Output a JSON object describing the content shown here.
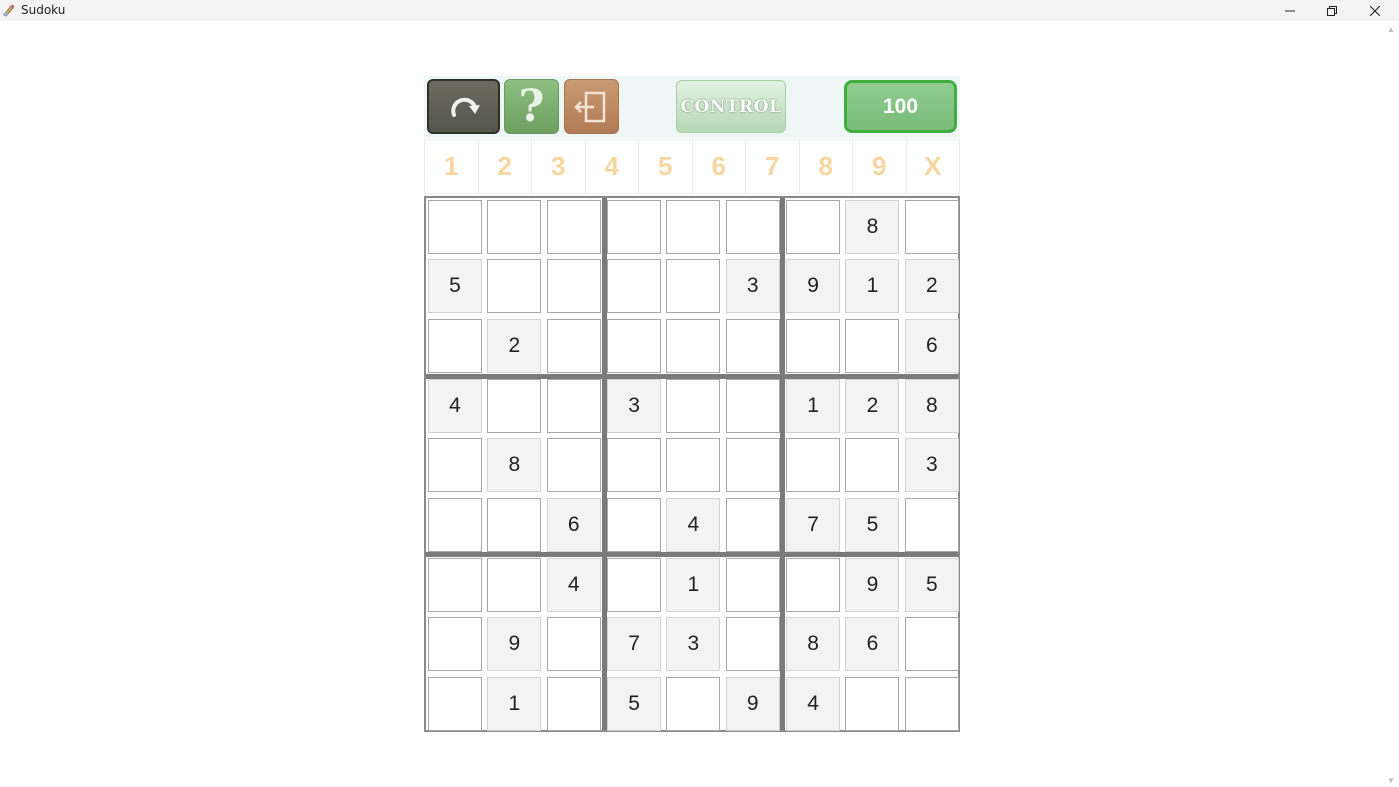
{
  "window": {
    "title": "Sudoku",
    "minimize_glyph": "─",
    "maximize_glyph": "❐",
    "close_glyph": "✕"
  },
  "toolbar": {
    "undo_icon": "rotate-arrow-icon",
    "help_icon": "question-mark-icon",
    "help_glyph": "?",
    "exit_icon": "exit-door-icon",
    "control_label": "CONTROL",
    "score": "100",
    "colors": {
      "undo": "#5f5f55",
      "help": "#7fb072",
      "exit": "#bd8a63",
      "control": "#c8e4c8",
      "score": "#84c484",
      "score_border": "#3fae3f"
    }
  },
  "number_picker": [
    "1",
    "2",
    "3",
    "4",
    "5",
    "6",
    "7",
    "8",
    "9",
    "X"
  ],
  "number_picker_color": "#f6d6a0",
  "board": [
    [
      "",
      "",
      "",
      "",
      "",
      "",
      "",
      "8",
      ""
    ],
    [
      "5",
      "",
      "",
      "",
      "",
      "3",
      "9",
      "1",
      "2"
    ],
    [
      "",
      "2",
      "",
      "",
      "",
      "",
      "",
      "",
      "6"
    ],
    [
      "4",
      "",
      "",
      "3",
      "",
      "",
      "1",
      "2",
      "8"
    ],
    [
      "",
      "8",
      "",
      "",
      "",
      "",
      "",
      "",
      "3"
    ],
    [
      "",
      "",
      "6",
      "",
      "4",
      "",
      "7",
      "5",
      ""
    ],
    [
      "",
      "",
      "4",
      "",
      "1",
      "",
      "",
      "9",
      "5"
    ],
    [
      "",
      "9",
      "",
      "7",
      "3",
      "",
      "8",
      "6",
      ""
    ],
    [
      "",
      "1",
      "",
      "5",
      "",
      "9",
      "4",
      "",
      ""
    ]
  ]
}
